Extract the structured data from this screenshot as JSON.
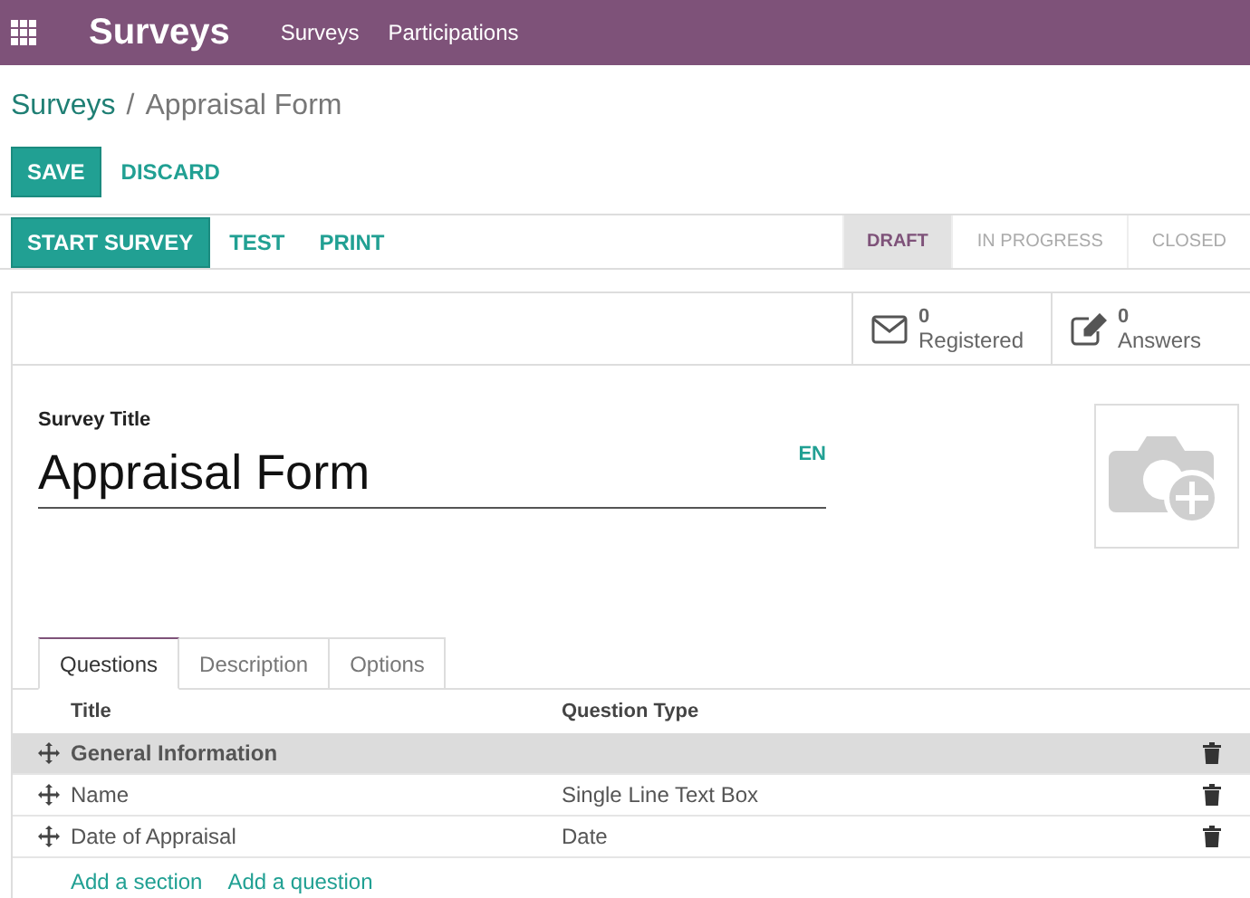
{
  "app_bar": {
    "title": "Surveys",
    "menu": [
      "Surveys",
      "Participations"
    ]
  },
  "breadcrumb": {
    "parent": "Surveys",
    "separator": "/",
    "current": "Appraisal Form"
  },
  "edit_buttons": [
    {
      "label": "SAVE",
      "kind": "primary"
    },
    {
      "label": "DISCARD",
      "kind": "link"
    }
  ],
  "header_buttons": [
    {
      "label": "START SURVEY",
      "kind": "primary"
    },
    {
      "label": "TEST",
      "kind": "link"
    },
    {
      "label": "PRINT",
      "kind": "link"
    }
  ],
  "stages": [
    {
      "label": "DRAFT",
      "selected": true
    },
    {
      "label": "IN PROGRESS",
      "selected": false
    },
    {
      "label": "CLOSED",
      "selected": false
    }
  ],
  "stat_buttons": [
    {
      "kind": "mail",
      "value": "0",
      "label": "Registered"
    },
    {
      "kind": "edit",
      "value": "0",
      "label": "Answers"
    }
  ],
  "form": {
    "field_label": "Survey Title",
    "title": "Appraisal Form",
    "language": "EN"
  },
  "tabs": [
    {
      "label": "Questions",
      "selected": true
    },
    {
      "label": "Description",
      "selected": false
    },
    {
      "label": "Options",
      "selected": false
    }
  ],
  "table": {
    "columns": [
      "Title",
      "Question Type"
    ],
    "rows": [
      {
        "kind": "section",
        "title": "General Information",
        "type": ""
      },
      {
        "kind": "question",
        "title": "Name",
        "type": "Single Line Text Box"
      },
      {
        "kind": "question",
        "title": "Date of Appraisal",
        "type": "Date"
      }
    ]
  },
  "add_links": [
    "Add a section",
    "Add a question"
  ]
}
